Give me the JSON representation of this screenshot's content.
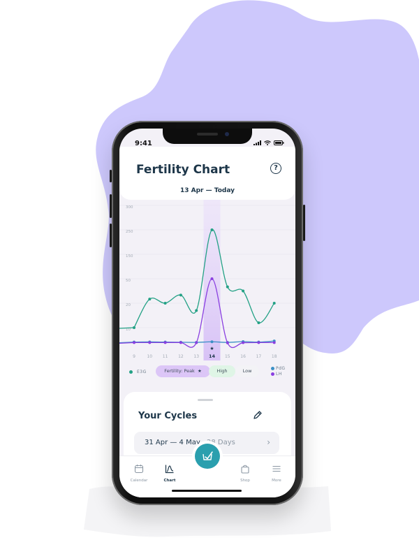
{
  "status": {
    "time": "9:41"
  },
  "header": {
    "title": "Fertility Chart",
    "date_range": "13 Apr — Today"
  },
  "chart_data": {
    "type": "line",
    "y_tick_labels": [
      "300",
      "250",
      "150",
      "50",
      "20",
      "10"
    ],
    "x_tick_labels": [
      "9",
      "10",
      "11",
      "12",
      "13",
      "14",
      "15",
      "16",
      "17",
      "18"
    ],
    "highlighted_day": "14",
    "series": [
      {
        "name": "E3G",
        "color": "#23a185",
        "values": [
          10,
          25,
          20,
          30,
          17,
          250,
          40,
          35,
          12,
          20
        ]
      },
      {
        "name": "PdG",
        "color": "#3b8fc6",
        "values": [
          0.6,
          0.7,
          0.6,
          0.5,
          0.4,
          0.8,
          0.4,
          0.9,
          0.6,
          1.3
        ]
      },
      {
        "name": "LH",
        "color": "#8a3fe0",
        "values": [
          0.3,
          0.3,
          0.3,
          0.3,
          0.2,
          50,
          0.1,
          0.2,
          0.3,
          0.3
        ]
      }
    ]
  },
  "legend": {
    "e3g": "E3G",
    "pdg": "PdG",
    "lh": "LH",
    "fertility_label": "Fertility: Peak",
    "high": "High",
    "low": "Low",
    "colors": {
      "e3g": "#23a185",
      "pdg": "#3b8fc6",
      "lh": "#8a3fe0",
      "peak_bg": "#dcc6f7",
      "high_bg": "#dff5e6"
    }
  },
  "cycles": {
    "title": "Your Cycles",
    "items": [
      {
        "dates": "31 Apr — 4 May",
        "days": "28 Days"
      }
    ]
  },
  "tabs": [
    {
      "label": "Calendar",
      "icon": "calendar-icon"
    },
    {
      "label": "Chart",
      "icon": "chart-icon"
    },
    {
      "label": "Shop",
      "icon": "shopping-bag-icon"
    },
    {
      "label": "More",
      "icon": "menu-icon"
    }
  ],
  "colors": {
    "blob": "#cdc8fc",
    "accent": "#2a9fae",
    "title": "#1d3649"
  }
}
